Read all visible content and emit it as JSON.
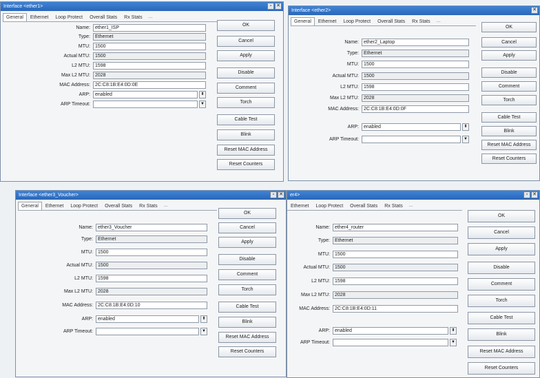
{
  "windows": [
    {
      "title": "Interface <ether1>",
      "tabs": [
        "General",
        "Ethernet",
        "Loop Protect",
        "Overall Stats",
        "Rx Stats"
      ],
      "tab_more": "...",
      "fields": [
        {
          "label": "Name:",
          "value": "ether1_ISP"
        },
        {
          "label": "Type:",
          "value": "Ethernet"
        },
        {
          "label": "MTU:",
          "value": "1500"
        },
        {
          "label": "Actual MTU:",
          "value": "1500"
        },
        {
          "label": "L2 MTU:",
          "value": "1598"
        },
        {
          "label": "Max L2 MTU:",
          "value": "2028"
        },
        {
          "label": "MAC Address:",
          "value": "2C:C8:1B:E4:0D:0E"
        },
        {
          "label": "ARP:",
          "value": "enabled"
        },
        {
          "label": "ARP Timeout:",
          "value": ""
        }
      ],
      "buttons": [
        "OK",
        "Cancel",
        "Apply",
        "Disable",
        "Comment",
        "Torch",
        "Cable Test",
        "Blink",
        "Reset MAC Address",
        "Reset Counters"
      ]
    },
    {
      "title": "Interface <ether2>",
      "tabs": [
        "General",
        "Ethernet",
        "Loop Protect",
        "Overall Stats",
        "Rx Stats"
      ],
      "tab_more": "...",
      "fields": [
        {
          "label": "Name:",
          "value": "ether2_Laptop"
        },
        {
          "label": "Type:",
          "value": "Ethernet"
        },
        {
          "label": "MTU:",
          "value": "1500"
        },
        {
          "label": "Actual MTU:",
          "value": "1500"
        },
        {
          "label": "L2 MTU:",
          "value": "1598"
        },
        {
          "label": "Max L2 MTU:",
          "value": "2028"
        },
        {
          "label": "MAC Address:",
          "value": "2C:C8:1B:E4:0D:0F"
        },
        {
          "label": "ARP:",
          "value": "enabled"
        },
        {
          "label": "ARP Timeout:",
          "value": ""
        }
      ],
      "buttons": [
        "OK",
        "Cancel",
        "Apply",
        "Disable",
        "Comment",
        "Torch",
        "Cable Test",
        "Blink",
        "Reset MAC Address",
        "Reset Counters"
      ]
    },
    {
      "title": "Interface <ether3_Voucher>",
      "tabs": [
        "General",
        "Ethernet",
        "Loop Protect",
        "Overall Stats",
        "Rx Stats"
      ],
      "tab_more": "...",
      "fields": [
        {
          "label": "Name:",
          "value": "ether3_Voucher"
        },
        {
          "label": "Type:",
          "value": "Ethernet"
        },
        {
          "label": "MTU:",
          "value": "1500"
        },
        {
          "label": "Actual MTU:",
          "value": "1500"
        },
        {
          "label": "L2 MTU:",
          "value": "1598"
        },
        {
          "label": "Max L2 MTU:",
          "value": "2028"
        },
        {
          "label": "MAC Address:",
          "value": "2C:C8:1B:E4:0D:10"
        },
        {
          "label": "ARP:",
          "value": "enabled"
        },
        {
          "label": "ARP Timeout:",
          "value": ""
        }
      ],
      "buttons": [
        "OK",
        "Cancel",
        "Apply",
        "Disable",
        "Comment",
        "Torch",
        "Cable Test",
        "Blink",
        "Reset MAC Address",
        "Reset Counters"
      ]
    },
    {
      "title": "er4>",
      "tabs": [
        "Ethernet",
        "Loop Protect",
        "Overall Stats",
        "Rx Stats"
      ],
      "tab_more": "...",
      "fields": [
        {
          "label": "Name:",
          "value": "ether4_router"
        },
        {
          "label": "Type:",
          "value": "Ethernet"
        },
        {
          "label": "MTU:",
          "value": "1500"
        },
        {
          "label": "Actual MTU:",
          "value": "1500"
        },
        {
          "label": "L2 MTU:",
          "value": "1598"
        },
        {
          "label": "Max L2 MTU:",
          "value": "2028"
        },
        {
          "label": "MAC Address:",
          "value": "2C:C8:1B:E4:0D:11"
        },
        {
          "label": "ARP:",
          "value": "enabled"
        },
        {
          "label": "ARP Timeout:",
          "value": ""
        }
      ],
      "buttons": [
        "OK",
        "Cancel",
        "Apply",
        "Disable",
        "Comment",
        "Torch",
        "Cable Test",
        "Blink",
        "Reset MAC Address",
        "Reset Counters"
      ]
    }
  ],
  "window_controls": {
    "restore": "▫",
    "close": "✕"
  },
  "dropdown_glyphs": {
    "updown": "⬍",
    "down": "▼"
  },
  "colors": {
    "titlebar": "#2f73c9",
    "field_bg": "#ffffff",
    "readonly_bg": "#eceef0"
  }
}
